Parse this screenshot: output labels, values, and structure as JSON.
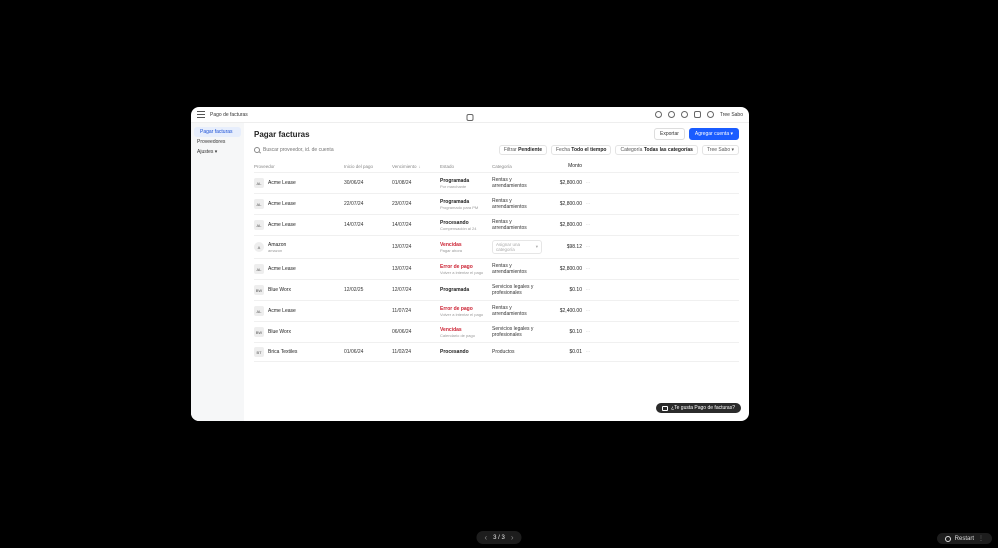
{
  "titlebar": {
    "app_name": "Pago de facturas",
    "user_name": "Tree Sabo"
  },
  "sidebar": {
    "items": [
      {
        "label": "Pagar facturas"
      },
      {
        "label": "Proveedores"
      },
      {
        "label": "Ajustes ▾"
      }
    ]
  },
  "page": {
    "title": "Pagar facturas",
    "export_label": "Exportar",
    "add_label": "Agregar cuenta  ▾"
  },
  "filters": {
    "search_placeholder": "Buscar proveedor, id. de cuenta",
    "filter_label": "Filtrar",
    "filter_value": "Pendiente",
    "date_label": "Fecha",
    "date_value": "Todo el tiempo",
    "cat_label": "Categoría",
    "cat_value": "Todas las categorías",
    "user_pill": "Tree Sabo ▾"
  },
  "columns": {
    "provider": "Proveedor",
    "start": "Inicio del pago",
    "due": "Vencimiento",
    "status": "Estado",
    "category": "Categoría",
    "amount": "Monto"
  },
  "category_placeholder": "Asignar una categoría",
  "rows": [
    {
      "badge": "AL",
      "badge_round": false,
      "name": "Acme Lease",
      "sub": "",
      "start": "30/06/24",
      "due": "01/08/24",
      "status": "Programada",
      "status_sub": "Por marchante",
      "status_red": false,
      "category": "Rentas y arrendamientos",
      "amount": "$2,800.00"
    },
    {
      "badge": "AL",
      "badge_round": false,
      "name": "Acme Lease",
      "sub": "",
      "start": "22/07/24",
      "due": "23/07/24",
      "status": "Programada",
      "status_sub": "Programado para PM",
      "status_red": false,
      "category": "Rentas y arrendamientos",
      "amount": "$2,800.00"
    },
    {
      "badge": "AL",
      "badge_round": false,
      "name": "Acme Lease",
      "sub": "",
      "start": "14/07/24",
      "due": "14/07/24",
      "status": "Procesando",
      "status_sub": "Compensación al 24",
      "status_red": false,
      "category": "Rentas y arrendamientos",
      "amount": "$2,800.00"
    },
    {
      "badge": "A",
      "badge_round": true,
      "name": "Amazon",
      "sub": "amazon",
      "start": "",
      "due": "13/07/24",
      "status": "Vencidas",
      "status_sub": "Pagar ahora",
      "status_red": true,
      "category": "__select__",
      "amount": "$98.12"
    },
    {
      "badge": "AL",
      "badge_round": false,
      "name": "Acme Lease",
      "sub": "",
      "start": "",
      "due": "13/07/24",
      "status": "Error de pago",
      "status_sub": "Volver a intentar el pago",
      "status_red": true,
      "category": "Rentas y arrendamientos",
      "amount": "$2,800.00"
    },
    {
      "badge": "BW",
      "badge_round": false,
      "name": "Blue Worx",
      "sub": "",
      "start": "12/02/25",
      "due": "12/07/24",
      "status": "Programada",
      "status_sub": "",
      "status_red": false,
      "category": "Servicios legales y profesionales",
      "amount": "$0.10"
    },
    {
      "badge": "AL",
      "badge_round": false,
      "name": "Acme Lease",
      "sub": "",
      "start": "",
      "due": "11/07/24",
      "status": "Error de pago",
      "status_sub": "Volver a intentar el pago",
      "status_red": true,
      "category": "Rentas y arrendamientos",
      "amount": "$2,400.00"
    },
    {
      "badge": "BW",
      "badge_round": false,
      "name": "Blue Worx",
      "sub": "",
      "start": "",
      "due": "06/06/24",
      "status": "Vencidas",
      "status_sub": "Calendario de pago",
      "status_red": true,
      "category": "Servicios legales y profesionales",
      "amount": "$0.10"
    },
    {
      "badge": "BT",
      "badge_round": false,
      "name": "Brica Textiles",
      "sub": "",
      "start": "01/06/24",
      "due": "11/02/24",
      "status": "Procesando",
      "status_sub": "",
      "status_red": false,
      "category": "Productos",
      "amount": "$0.01"
    }
  ],
  "feedback": {
    "text": "¿Te gusta Pago de facturas?"
  },
  "pager": {
    "text": "3 / 3"
  },
  "restart": {
    "label": "Restart"
  }
}
